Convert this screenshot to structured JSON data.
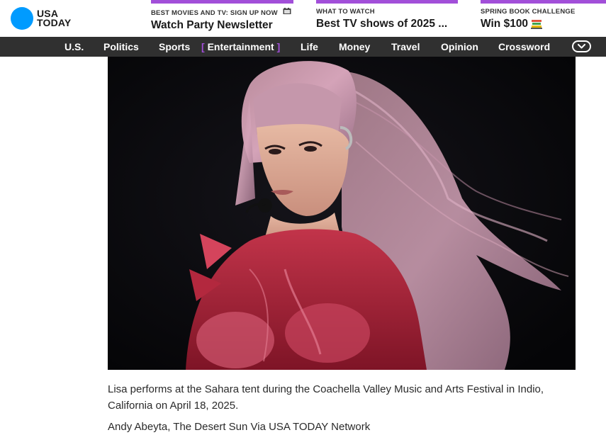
{
  "brand": {
    "line1": "USA",
    "line2": "TODAY",
    "color": "#009bff"
  },
  "promos": [
    {
      "kicker": "BEST MOVIES AND TV: SIGN UP NOW",
      "title": "Watch Party Newsletter",
      "icon": "film-icon"
    },
    {
      "kicker": "WHAT TO WATCH",
      "title": "Best TV shows of 2025 ..."
    },
    {
      "kicker": "SPRING BOOK CHALLENGE",
      "title": "Win $100",
      "icon": "books-icon"
    }
  ],
  "nav": {
    "items": [
      "U.S.",
      "Politics",
      "Sports",
      "Entertainment",
      "Life",
      "Money",
      "Travel",
      "Opinion",
      "Crossword"
    ],
    "active": "Entertainment",
    "accent": "#a24fd9",
    "bracket_open": "[",
    "bracket_close": "]"
  },
  "photo": {
    "caption": "Lisa performs at the Sahara tent during the Coachella Valley Music and Arts Festival in Indio, California on April 18, 2025.",
    "credit": "Andy Abeyta, The Desert Sun Via USA TODAY Network"
  }
}
